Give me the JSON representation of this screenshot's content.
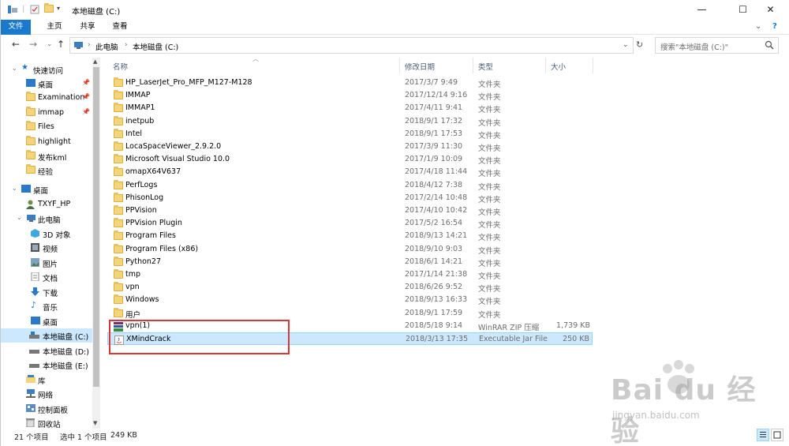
{
  "window": {
    "title": "本地磁盘 (C:)",
    "controls": {
      "minimize": "—",
      "maximize": "☐",
      "close": "✕"
    }
  },
  "ribbon": {
    "tabs": [
      "文件",
      "主页",
      "共享",
      "查看"
    ],
    "expand_glyph": "⌄",
    "help_glyph": "?"
  },
  "nav": {
    "back": "←",
    "forward": "→",
    "dropdown": "⌄",
    "up": "↑",
    "breadcrumbs": [
      "此电脑",
      "本地磁盘 (C:)"
    ],
    "separator": "›",
    "refresh": "↻",
    "search_placeholder": "搜索\"本地磁盘 (C:)\""
  },
  "sidebar": {
    "items": [
      {
        "label": "快速访问",
        "icon": "star-icon",
        "pinned": false
      },
      {
        "label": "桌面",
        "icon": "desktop-icon",
        "pinned": true
      },
      {
        "label": "Examination",
        "icon": "folder-icon",
        "pinned": true
      },
      {
        "label": "immap",
        "icon": "folder-icon",
        "pinned": true
      },
      {
        "label": "Files",
        "icon": "folder-icon",
        "pinned": false
      },
      {
        "label": "highlight",
        "icon": "folder-icon",
        "pinned": false
      },
      {
        "label": "发布kml",
        "icon": "folder-icon",
        "pinned": false
      },
      {
        "label": "经验",
        "icon": "folder-icon",
        "pinned": false
      },
      {
        "label": "桌面",
        "icon": "desktop-icon",
        "pinned": false
      },
      {
        "label": "TXYF_HP",
        "icon": "user-icon",
        "pinned": false
      },
      {
        "label": "此电脑",
        "icon": "computer-icon",
        "pinned": false
      },
      {
        "label": "3D 对象",
        "icon": "cube-icon",
        "pinned": false
      },
      {
        "label": "视频",
        "icon": "video-icon",
        "pinned": false
      },
      {
        "label": "图片",
        "icon": "picture-icon",
        "pinned": false
      },
      {
        "label": "文档",
        "icon": "document-icon",
        "pinned": false
      },
      {
        "label": "下载",
        "icon": "download-icon",
        "pinned": false
      },
      {
        "label": "音乐",
        "icon": "music-icon",
        "pinned": false
      },
      {
        "label": "桌面",
        "icon": "desktop-icon",
        "pinned": false
      },
      {
        "label": "本地磁盘 (C:)",
        "icon": "drive-icon",
        "pinned": false
      },
      {
        "label": "本地磁盘 (D:)",
        "icon": "drive-icon",
        "pinned": false
      },
      {
        "label": "本地磁盘 (E:)",
        "icon": "drive-icon",
        "pinned": false
      },
      {
        "label": "库",
        "icon": "library-icon",
        "pinned": false
      },
      {
        "label": "网络",
        "icon": "network-icon",
        "pinned": false
      },
      {
        "label": "控制面板",
        "icon": "control-panel-icon",
        "pinned": false
      },
      {
        "label": "回收站",
        "icon": "recycle-bin-icon",
        "pinned": false
      }
    ],
    "selected_index": 18
  },
  "columns": {
    "name": "名称",
    "modified": "修改日期",
    "type": "类型",
    "size": "大小"
  },
  "files": [
    {
      "name": "HP_LaserJet_Pro_MFP_M127-M128",
      "modified": "2017/3/7 9:49",
      "type": "文件夹",
      "size": "",
      "icon": "folder-icon"
    },
    {
      "name": "IMMAP",
      "modified": "2017/12/14 9:16",
      "type": "文件夹",
      "size": "",
      "icon": "folder-icon"
    },
    {
      "name": "IMMAP1",
      "modified": "2017/4/11 9:41",
      "type": "文件夹",
      "size": "",
      "icon": "folder-icon"
    },
    {
      "name": "inetpub",
      "modified": "2018/9/1 17:32",
      "type": "文件夹",
      "size": "",
      "icon": "folder-icon"
    },
    {
      "name": "Intel",
      "modified": "2018/9/1 17:53",
      "type": "文件夹",
      "size": "",
      "icon": "folder-icon"
    },
    {
      "name": "LocaSpaceViewer_2.9.2.0",
      "modified": "2017/3/9 11:30",
      "type": "文件夹",
      "size": "",
      "icon": "folder-icon"
    },
    {
      "name": "Microsoft Visual Studio 10.0",
      "modified": "2017/1/9 10:09",
      "type": "文件夹",
      "size": "",
      "icon": "folder-icon"
    },
    {
      "name": "omapX64V637",
      "modified": "2017/4/18 11:44",
      "type": "文件夹",
      "size": "",
      "icon": "folder-icon"
    },
    {
      "name": "PerfLogs",
      "modified": "2018/4/12 7:38",
      "type": "文件夹",
      "size": "",
      "icon": "folder-icon"
    },
    {
      "name": "PhisonLog",
      "modified": "2017/2/14 10:48",
      "type": "文件夹",
      "size": "",
      "icon": "folder-icon"
    },
    {
      "name": "PPVision",
      "modified": "2017/4/10 10:42",
      "type": "文件夹",
      "size": "",
      "icon": "folder-icon"
    },
    {
      "name": "PPVision Plugin",
      "modified": "2017/5/2 16:54",
      "type": "文件夹",
      "size": "",
      "icon": "folder-icon"
    },
    {
      "name": "Program Files",
      "modified": "2018/9/13 14:21",
      "type": "文件夹",
      "size": "",
      "icon": "folder-icon"
    },
    {
      "name": "Program Files (x86)",
      "modified": "2018/9/10 9:03",
      "type": "文件夹",
      "size": "",
      "icon": "folder-icon"
    },
    {
      "name": "Python27",
      "modified": "2018/6/1 14:21",
      "type": "文件夹",
      "size": "",
      "icon": "folder-icon"
    },
    {
      "name": "tmp",
      "modified": "2017/1/14 21:38",
      "type": "文件夹",
      "size": "",
      "icon": "folder-icon"
    },
    {
      "name": "vpn",
      "modified": "2018/6/26 9:52",
      "type": "文件夹",
      "size": "",
      "icon": "folder-icon"
    },
    {
      "name": "Windows",
      "modified": "2018/9/13 16:33",
      "type": "文件夹",
      "size": "",
      "icon": "folder-icon"
    },
    {
      "name": "用户",
      "modified": "2018/9/1 17:59",
      "type": "文件夹",
      "size": "",
      "icon": "folder-icon"
    },
    {
      "name": "vpn(1)",
      "modified": "2018/5/18 9:14",
      "type": "WinRAR ZIP 压缩",
      "size": "1,739 KB",
      "icon": "winrar-archive-icon"
    },
    {
      "name": "XMindCrack",
      "modified": "2018/3/13 17:35",
      "type": "Executable Jar File",
      "size": "250 KB",
      "icon": "jar-file-icon"
    }
  ],
  "selected_file_index": 20,
  "status": {
    "item_count": "21 个项目",
    "selected": "选中 1 个项目",
    "selected_size": "249 KB"
  },
  "watermark": {
    "main": "Bai du 经验",
    "sub": "jingyan.baidu.com"
  },
  "colors": {
    "accent": "#1979ca",
    "selection": "#cce8ff",
    "highlight_box": "#d9373a"
  }
}
